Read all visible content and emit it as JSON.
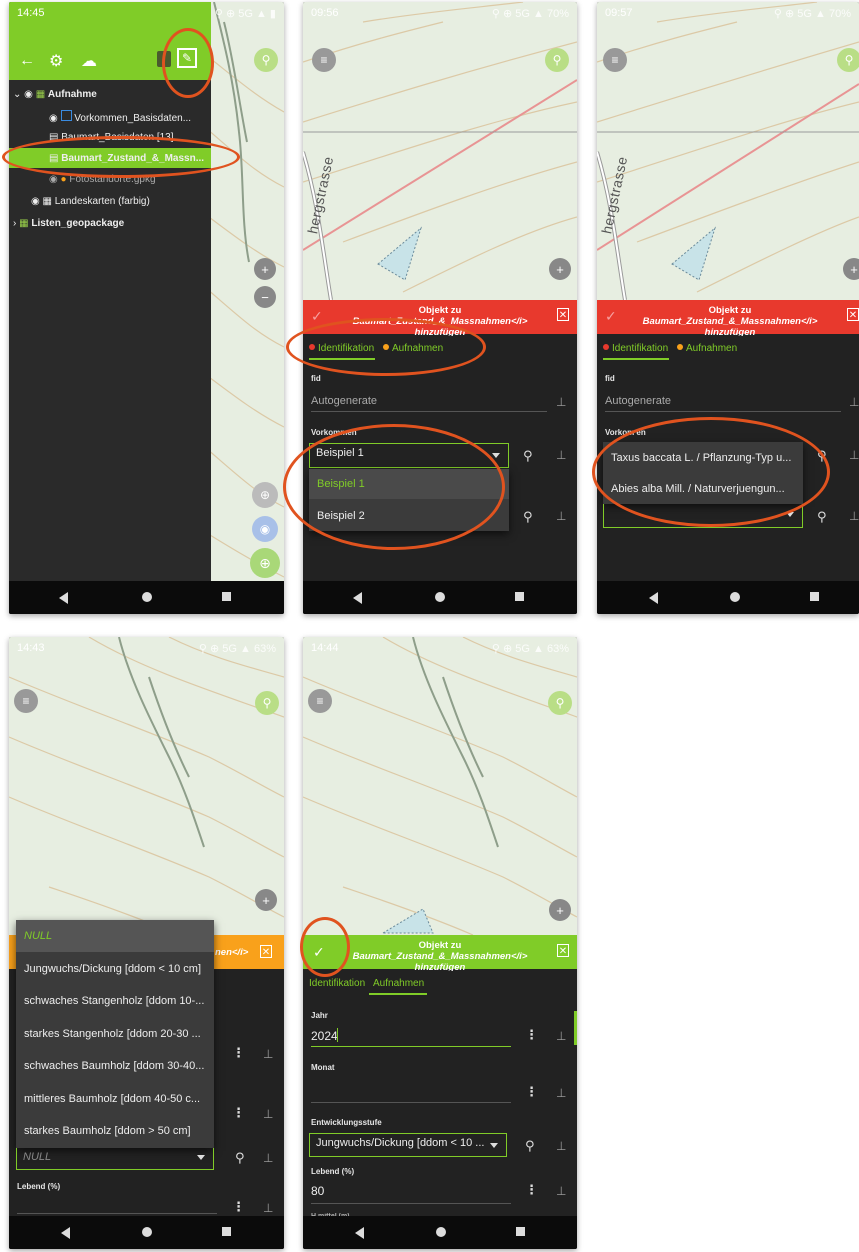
{
  "screen1": {
    "time": "14:45",
    "layers": [
      "Aufnahme",
      "Vorkommen_Basisdaten...",
      "Baumart_Basisdaten [13]",
      "Baumart_Zustand_&_Massn...",
      "Fotostandorte.gpkg",
      "Landeskarten (farbig)",
      "Listen_geopackage"
    ]
  },
  "screen2": {
    "time": "09:56",
    "battery": "70%",
    "map_label": "hergstrasse",
    "header_prefix": "Objekt zu ",
    "header_layer": "Baumart_Zustand_&_Massnahmen</i>",
    "header_suffix": "hinzufügen",
    "tab1": "Identifikation",
    "tab2": "Aufnahmen",
    "fid_label": "fid",
    "fid_value": "Autogenerate",
    "vorkommen_label": "Vorkommen",
    "selected": "Beispiel 1",
    "options": [
      "Beispiel 1",
      "Beispiel 2"
    ]
  },
  "screen3": {
    "time": "09:57",
    "battery": "70%",
    "map_label": "hergstrasse",
    "header_prefix": "Objekt zu ",
    "header_layer": "Baumart_Zustand_&_Massnahmen</i>",
    "header_suffix": "hinzufügen",
    "tab1": "Identifikation",
    "tab2": "Aufnahmen",
    "fid_label": "fid",
    "fid_value": "Autogenerate",
    "vorkommen_label": "Vorkom  en",
    "options": [
      "Taxus baccata L. / Pflanzung-Typ u...",
      "Abies alba Mill. / Naturverjuengun..."
    ]
  },
  "screen4": {
    "time": "14:43",
    "battery": "63%",
    "header_tail": "nen</i>",
    "options": [
      "NULL",
      "Jungwuchs/Dickung [ddom < 10 cm]",
      "schwaches Stangenholz [ddom 10-...",
      "starkes Stangenholz [ddom 20-30 ...",
      "schwaches Baumholz [ddom 30-40...",
      "mittleres Baumholz [ddom 40-50 c...",
      "starkes Baumholz [ddom > 50 cm]"
    ],
    "field_value": "NULL",
    "lebend_label": "Lebend (%)"
  },
  "screen5": {
    "time": "14:44",
    "battery": "63%",
    "header_prefix": "Objekt zu ",
    "header_layer": "Baumart_Zustand_&_Massnahmen</i>",
    "header_suffix": "hinzufügen",
    "tab1": "Identifikation",
    "tab2": "Aufnahmen",
    "jahr_label": "Jahr",
    "jahr_value": "2024",
    "monat_label": "Monat",
    "entw_label": "Entwicklungsstufe",
    "entw_value": "Jungwuchs/Dickung [ddom < 10 ...",
    "lebend_label": "Lebend (%)",
    "lebend_value": "80",
    "cut_label": "H mittel (m)"
  },
  "colors": {
    "green": "#80cc28",
    "red": "#e8392d",
    "orange": "#f9a11b",
    "ring": "#e0531f"
  }
}
